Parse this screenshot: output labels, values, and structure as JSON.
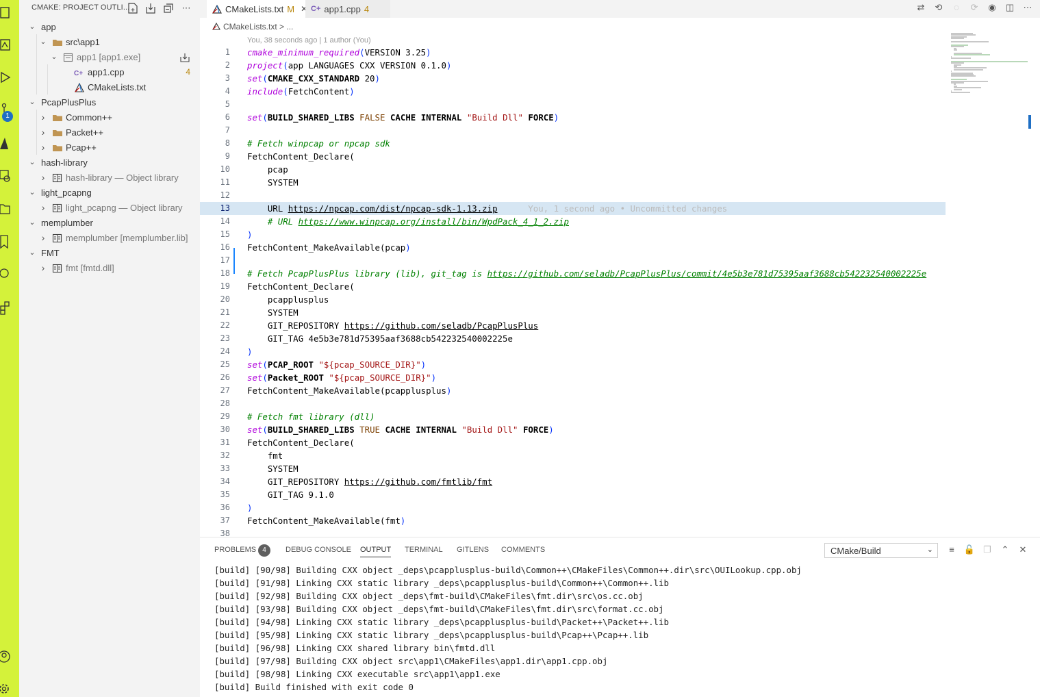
{
  "activity_bar": {
    "color": "#d4f23a",
    "badge": "1"
  },
  "sidebar": {
    "title": "CMAKE: PROJECT OUTLI...",
    "tree": [
      {
        "label": "app",
        "kind": "project",
        "expanded": true
      },
      {
        "label": "src\\app1",
        "kind": "folder",
        "expanded": true
      },
      {
        "label": "app1 [app1.exe]",
        "kind": "executable",
        "expanded": true
      },
      {
        "label": "app1.cpp",
        "kind": "cpp-file",
        "count": "4"
      },
      {
        "label": "CMakeLists.txt",
        "kind": "cmake-file"
      },
      {
        "label": "PcapPlusPlus",
        "kind": "project",
        "expanded": true
      },
      {
        "label": "Common++",
        "kind": "folder",
        "expanded": false
      },
      {
        "label": "Packet++",
        "kind": "folder",
        "expanded": false
      },
      {
        "label": "Pcap++",
        "kind": "folder",
        "expanded": false
      },
      {
        "label": "hash-library",
        "kind": "project",
        "expanded": true
      },
      {
        "label": "hash-library — Object library",
        "kind": "library",
        "expanded": false
      },
      {
        "label": "light_pcapng",
        "kind": "project",
        "expanded": true
      },
      {
        "label": "light_pcapng — Object library",
        "kind": "library",
        "expanded": false
      },
      {
        "label": "memplumber",
        "kind": "project",
        "expanded": true
      },
      {
        "label": "memplumber [memplumber.lib]",
        "kind": "library",
        "expanded": false
      },
      {
        "label": "FMT",
        "kind": "project",
        "expanded": true
      },
      {
        "label": "fmt [fmtd.dll]",
        "kind": "library",
        "expanded": false
      }
    ]
  },
  "editor": {
    "tabs": [
      {
        "label": "CMakeLists.txt",
        "status": "M",
        "active": true
      },
      {
        "label": "app1.cpp",
        "status": "4",
        "active": false
      }
    ],
    "breadcrumb": "CMakeLists.txt > ...",
    "blame_header": "You, 38 seconds ago | 1 author (You)",
    "current_line": 13,
    "inline_blame": "You, 1 second ago • Uncommitted changes",
    "lines": [
      "cmake_minimum_required(VERSION 3.25)",
      "project(app LANGUAGES CXX VERSION 0.1.0)",
      "set(CMAKE_CXX_STANDARD 20)",
      "include(FetchContent)",
      "",
      "set(BUILD_SHARED_LIBS FALSE CACHE INTERNAL \"Build Dll\" FORCE)",
      "",
      "# Fetch winpcap or npcap sdk",
      "FetchContent_Declare(",
      "    pcap",
      "    SYSTEM",
      "",
      "    URL https://npcap.com/dist/npcap-sdk-1.13.zip",
      "    # URL https://www.winpcap.org/install/bin/WpdPack_4_1_2.zip",
      ")",
      "FetchContent_MakeAvailable(pcap)",
      "",
      "# Fetch PcapPlusPlus library (lib), git_tag is https://github.com/seladb/PcapPlusPlus/commit/4e5b3e781d75395aaf3688cb542232540002225e",
      "FetchContent_Declare(",
      "    pcapplusplus",
      "    SYSTEM",
      "    GIT_REPOSITORY https://github.com/seladb/PcapPlusPlus",
      "    GIT_TAG 4e5b3e781d75395aaf3688cb542232540002225e",
      ")",
      "set(PCAP_ROOT \"${pcap_SOURCE_DIR}\")",
      "set(Packet_ROOT \"${pcap_SOURCE_DIR}\")",
      "FetchContent_MakeAvailable(pcapplusplus)",
      "",
      "# Fetch fmt library (dll)",
      "set(BUILD_SHARED_LIBS TRUE CACHE INTERNAL \"Build Dll\" FORCE)",
      "FetchContent_Declare(",
      "    fmt",
      "    SYSTEM",
      "    GIT_REPOSITORY https://github.com/fmtlib/fmt",
      "    GIT_TAG 9.1.0",
      ")",
      "FetchContent_MakeAvailable(fmt)",
      ""
    ]
  },
  "panel": {
    "tabs": [
      "PROBLEMS",
      "DEBUG CONSOLE",
      "OUTPUT",
      "TERMINAL",
      "GITLENS",
      "COMMENTS"
    ],
    "problems_count": "4",
    "active_tab": "OUTPUT",
    "output_channel": "CMake/Build",
    "output_lines": [
      "[build] [90/98] Building CXX object _deps\\pcapplusplus-build\\Common++\\CMakeFiles\\Common++.dir\\src\\OUILookup.cpp.obj",
      "[build] [91/98] Linking CXX static library _deps\\pcapplusplus-build\\Common++\\Common++.lib",
      "[build] [92/98] Building CXX object _deps\\fmt-build\\CMakeFiles\\fmt.dir\\src\\os.cc.obj",
      "[build] [93/98] Building CXX object _deps\\fmt-build\\CMakeFiles\\fmt.dir\\src\\format.cc.obj",
      "[build] [94/98] Linking CXX static library _deps\\pcapplusplus-build\\Packet++\\Packet++.lib",
      "[build] [95/98] Linking CXX static library _deps\\pcapplusplus-build\\Pcap++\\Pcap++.lib",
      "[build] [96/98] Linking CXX shared library bin\\fmtd.dll",
      "[build] [97/98] Building CXX object src\\app1\\CMakeFiles\\app1.dir\\app1.cpp.obj",
      "[build] [98/98] Linking CXX executable src\\app1\\app1.exe",
      "[build] Build finished with exit code 0"
    ]
  }
}
